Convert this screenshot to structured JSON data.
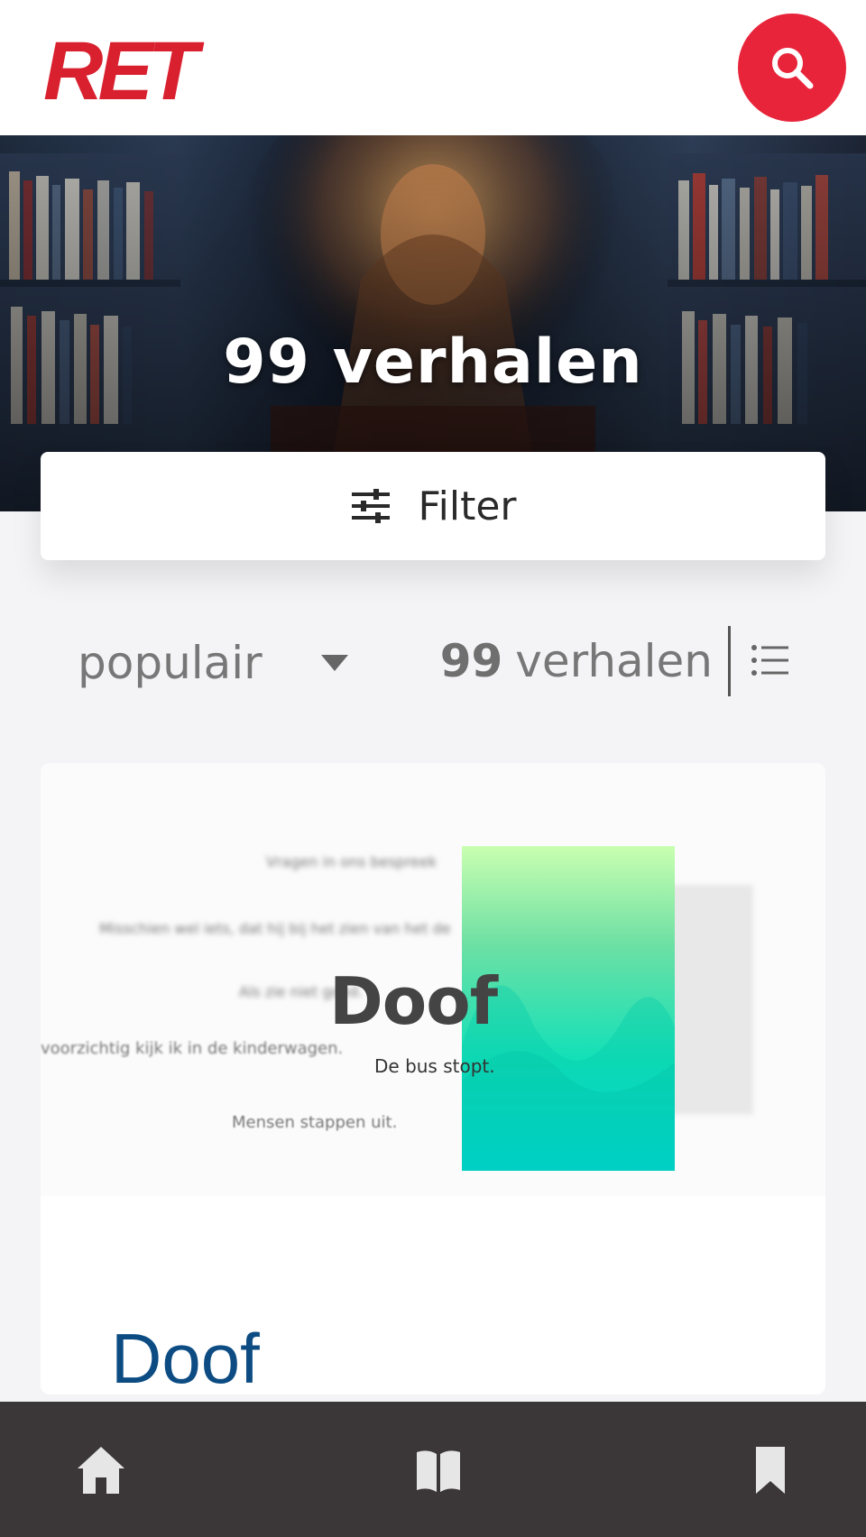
{
  "header": {
    "logo_text": "RET",
    "search_icon": "search-icon",
    "brand_color": "#e8243a"
  },
  "hero": {
    "title": "99 verhalen"
  },
  "filter": {
    "label": "Filter",
    "icon": "sliders-icon"
  },
  "sort": {
    "selected": "populair",
    "icon": "caret-down-icon"
  },
  "results": {
    "count": "99",
    "count_label": "verhalen",
    "view_icon": "list-view-icon"
  },
  "story": {
    "image_title": "Doof",
    "image_subtitle": "De bus stopt.",
    "image_lines": [
      "Vragen in ons bespreek",
      "Misschien wel iets, dat hij bij het zien van het de",
      "Als zie niet goed.",
      "voorzichtig kijk ik in de kinderwagen.",
      "Mensen stappen uit."
    ],
    "title": "Doof"
  },
  "bottom_nav": {
    "items": [
      {
        "icon": "home-icon"
      },
      {
        "icon": "book-icon"
      },
      {
        "icon": "bookmark-icon"
      }
    ]
  }
}
